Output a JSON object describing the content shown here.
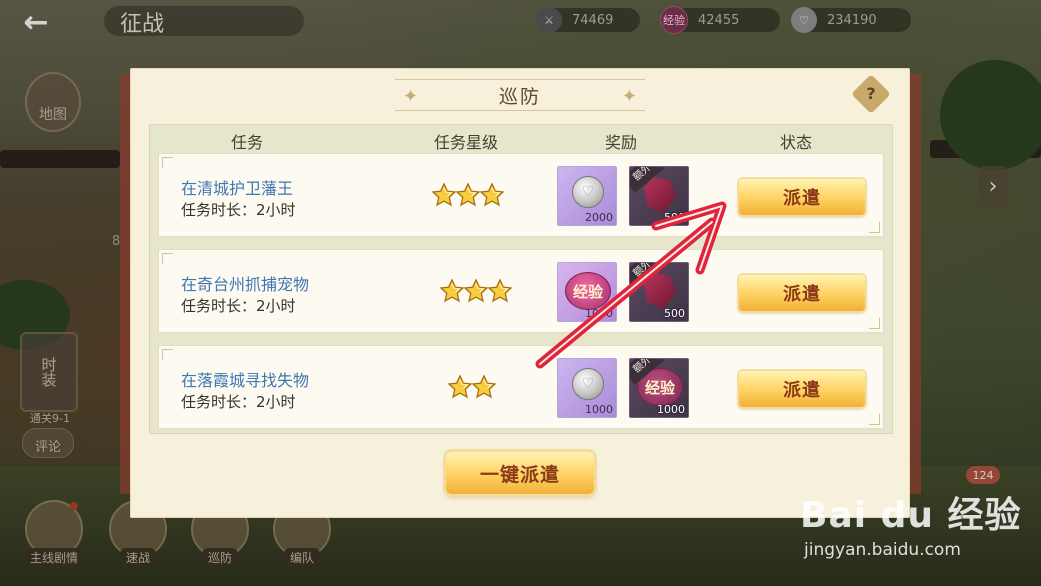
{
  "topbar": {
    "title": "征战",
    "resources": [
      {
        "icon": "sword-icon",
        "value": "74469"
      },
      {
        "icon": "exp-icon",
        "glyph": "经验",
        "value": "42455"
      },
      {
        "icon": "silver-coin-icon",
        "value": "234190"
      }
    ]
  },
  "left_panel": {
    "map_label": "地图",
    "costume_label": "时装",
    "clear_label": "通关9-1",
    "comment_label": "评论",
    "side_number": "8"
  },
  "bottom_nav": [
    {
      "label": "主线剧情",
      "has_dot": true
    },
    {
      "label": "速战",
      "has_dot": false
    },
    {
      "label": "巡防",
      "has_dot": false
    },
    {
      "label": "编队",
      "has_dot": false
    }
  ],
  "right_panel": {
    "count_badge": "124"
  },
  "modal": {
    "title": "巡防",
    "help_glyph": "?",
    "headers": {
      "task": "任务",
      "stars": "任务星级",
      "reward": "奖励",
      "status": "状态"
    },
    "rows": [
      {
        "name": "在清城护卫藩王",
        "duration": "任务时长：2小时",
        "stars": 3,
        "rewards": [
          {
            "type": "silver",
            "qty": "2000"
          },
          {
            "type": "gem",
            "bonus": "额外",
            "qty": "500"
          }
        ],
        "action": "派遣"
      },
      {
        "name": "在奇台州抓捕宠物",
        "duration": "任务时长：2小时",
        "stars": 3,
        "rewards": [
          {
            "type": "exp",
            "glyph": "经验",
            "qty": "1000"
          },
          {
            "type": "gem",
            "bonus": "额外",
            "qty": "500"
          }
        ],
        "action": "派遣"
      },
      {
        "name": "在落霞城寻找失物",
        "duration": "任务时长：2小时",
        "stars": 2,
        "rewards": [
          {
            "type": "silver",
            "qty": "1000"
          },
          {
            "type": "exp",
            "bonus": "额外",
            "glyph": "经验",
            "qty": "1000"
          }
        ],
        "action": "派遣"
      }
    ],
    "one_click_label": "一键派遣"
  },
  "watermark": {
    "logo": "Bai du 经验",
    "url": "jingyan.baidu.com"
  },
  "colors": {
    "task_name": "#3f77b3",
    "button_text": "#8a3a16",
    "modal_bg": "#f7f1dc",
    "arrow": "#e0243a"
  }
}
